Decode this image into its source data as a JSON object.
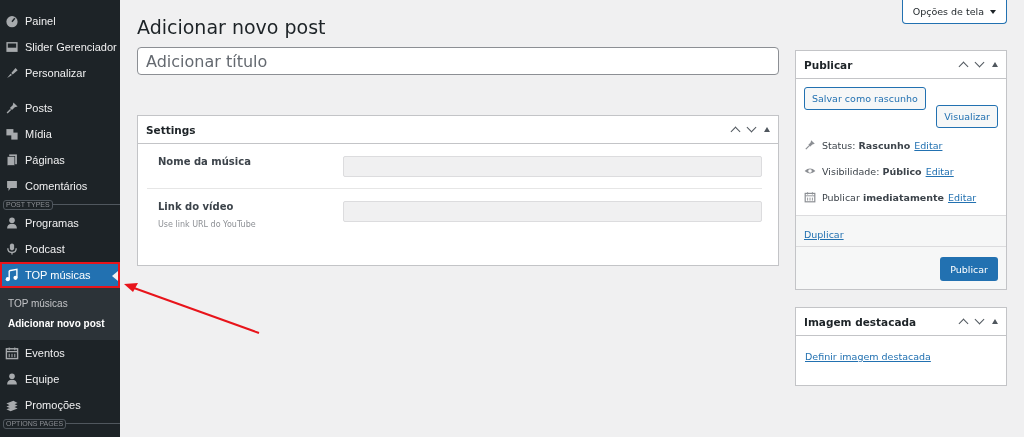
{
  "sidebar": {
    "items": [
      {
        "kind": "gauge",
        "label": "Painel",
        "selected": false
      },
      {
        "kind": "image",
        "label": "Slider Gerenciador",
        "selected": false
      },
      {
        "kind": "brush",
        "label": "Personalizar",
        "selected": false
      },
      {
        "kind": "separator"
      },
      {
        "kind": "pin",
        "label": "Posts",
        "selected": false
      },
      {
        "kind": "media",
        "label": "Mídia",
        "selected": false
      },
      {
        "kind": "pages",
        "label": "Páginas",
        "selected": false
      },
      {
        "kind": "comment",
        "label": "Comentários",
        "selected": false
      },
      {
        "kind": "section",
        "label": "POST TYPES"
      },
      {
        "kind": "person",
        "label": "Programas",
        "selected": false
      },
      {
        "kind": "microphone",
        "label": "Podcast",
        "selected": false
      },
      {
        "kind": "music",
        "label": "TOP músicas",
        "selected": true,
        "highlighted": true,
        "submenu": [
          {
            "label": "TOP músicas",
            "selected": false
          },
          {
            "label": "Adicionar novo post",
            "selected": true
          }
        ]
      },
      {
        "kind": "calendar",
        "label": "Eventos",
        "selected": false
      },
      {
        "kind": "person",
        "label": "Equipe",
        "selected": false
      },
      {
        "kind": "stack",
        "label": "Promoções",
        "selected": false
      },
      {
        "kind": "section",
        "label": "OPTIONS PAGES"
      }
    ]
  },
  "screen_options": {
    "label": "Opções de tela"
  },
  "page_title": "Adicionar novo post",
  "title_field": {
    "placeholder": "Adicionar título"
  },
  "settings_box": {
    "title": "Settings",
    "fields": [
      {
        "label": "Nome da música"
      },
      {
        "label": "Link do vídeo",
        "hint": "Use link URL do YouTube"
      }
    ]
  },
  "publish_box": {
    "title": "Publicar",
    "save_draft": "Salvar como rascunho",
    "preview": "Visualizar",
    "rows": [
      {
        "kind": "pin",
        "label": "Status:",
        "value": "Rascunho",
        "link": "Editar"
      },
      {
        "kind": "eye",
        "label": "Visibilidade:",
        "value": "Público",
        "link": "Editar"
      },
      {
        "kind": "calendar",
        "label": "Publicar",
        "value": "imediatamente",
        "link": "Editar"
      }
    ],
    "duplicate": "Duplicar",
    "publish": "Publicar"
  },
  "featured_image_box": {
    "title": "Imagem destacada",
    "link": "Definir imagem destacada"
  },
  "annotation": {
    "arrow": true
  }
}
